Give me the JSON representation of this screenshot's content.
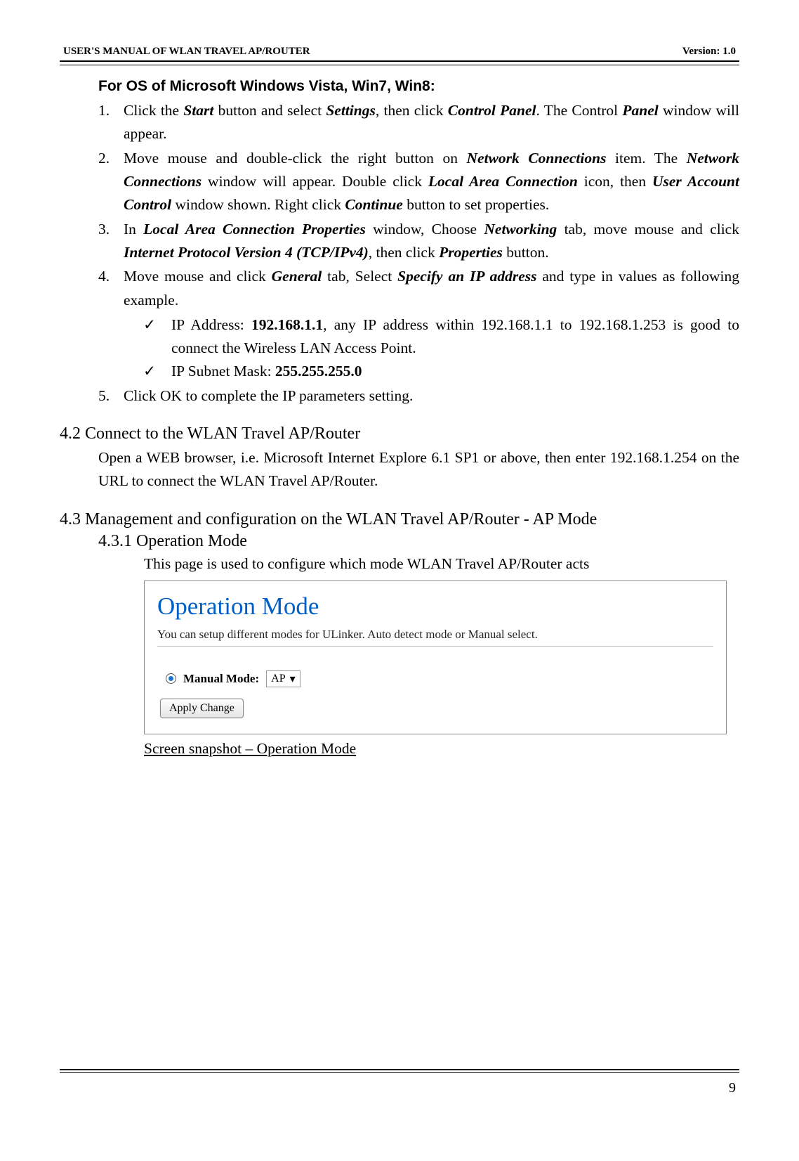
{
  "header": {
    "title": "USER'S MANUAL OF WLAN TRAVEL AP/ROUTER",
    "version": "Version: 1.0"
  },
  "os_title": "For OS of Microsoft Windows Vista, Win7, Win8:",
  "step1": {
    "num": "1.",
    "t1": "Click the ",
    "start": "Start",
    "t2": " button and select ",
    "settings": "Settings",
    "t3": ", then click ",
    "cp": "Control Panel",
    "t4": ". The Control ",
    "panel": "Panel",
    "t5": " window will appear."
  },
  "step2": {
    "num": "2.",
    "t1": "Move mouse and double-click the right button on ",
    "nc": "Network Connections",
    "t2": " item. The ",
    "nc2": "Network Connections",
    "t3": " window will appear. Double click ",
    "lac": "Local Area Connection",
    "t4": " icon, then ",
    "uac": "User Account Control",
    "t5": " window shown. Right click ",
    "cont": "Continue",
    "t6": " button to set properties."
  },
  "step3": {
    "num": "3.",
    "t1": "In ",
    "lacp": "Local Area Connection Properties",
    "t2": " window, Choose ",
    "net": "Networking",
    "t3": " tab, move mouse and click ",
    "ipv4": "Internet Protocol Version 4 (TCP/IPv4)",
    "t4": ", then click ",
    "prop": "Properties",
    "t5": " button."
  },
  "step4": {
    "num": "4.",
    "t1": "Move mouse and click ",
    "gen": "General",
    "t2": " tab, Select ",
    "spec": "Specify an IP address",
    "t3": " and type in values as following example."
  },
  "check1": {
    "tick": "✓",
    "t1": "IP Address: ",
    "ip": "192.168.1.1",
    "t2": ", any IP address within 192.168.1.1 to 192.168.1.253 is good to connect the Wireless LAN Access Point."
  },
  "check2": {
    "tick": "✓",
    "t1": "IP Subnet Mask: ",
    "mask": "255.255.255.0"
  },
  "step5": {
    "num": "5.",
    "txt": "Click OK to complete the IP parameters setting."
  },
  "sec42": {
    "h": "4.2  Connect to the WLAN Travel AP/Router",
    "body": "Open a WEB browser, i.e. Microsoft Internet Explore 6.1 SP1 or above, then enter 192.168.1.254 on the URL to connect the WLAN Travel AP/Router."
  },
  "sec43": {
    "h": "4.3  Management and configuration on the WLAN Travel AP/Router - AP Mode",
    "sub_h": "4.3.1  Operation Mode",
    "sub_body": "This page is used to configure which mode WLAN Travel AP/Router acts"
  },
  "screenshot": {
    "title": "Operation Mode",
    "desc": "You can setup different modes for ULinker. Auto detect mode or Manual select.",
    "manual_label": "Manual Mode:",
    "select_value": "AP",
    "apply_label": "Apply Change"
  },
  "caption": "Screen snapshot – Operation Mode",
  "page_number": "9"
}
